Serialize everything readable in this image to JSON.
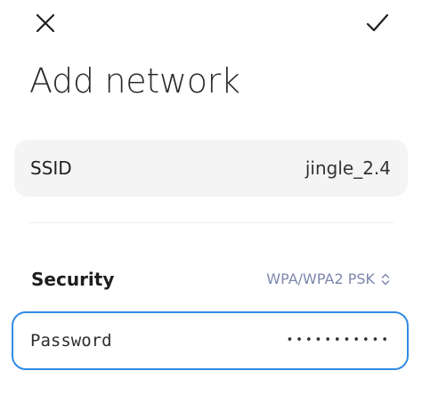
{
  "header": {
    "close_icon": "close-icon",
    "confirm_icon": "checkmark-icon",
    "title": "Add network"
  },
  "ssid": {
    "label": "SSID",
    "value": "jingle_2.4"
  },
  "security": {
    "label": "Security",
    "value": "WPA/WPA2 PSK",
    "chevron_icon": "chevron-up-down-icon"
  },
  "password": {
    "label": "Password",
    "masked_value": "•••••••••••"
  },
  "colors": {
    "accent": "#2f8be6",
    "security_value": "#7d87ad",
    "row_background": "#f4f4f4"
  }
}
